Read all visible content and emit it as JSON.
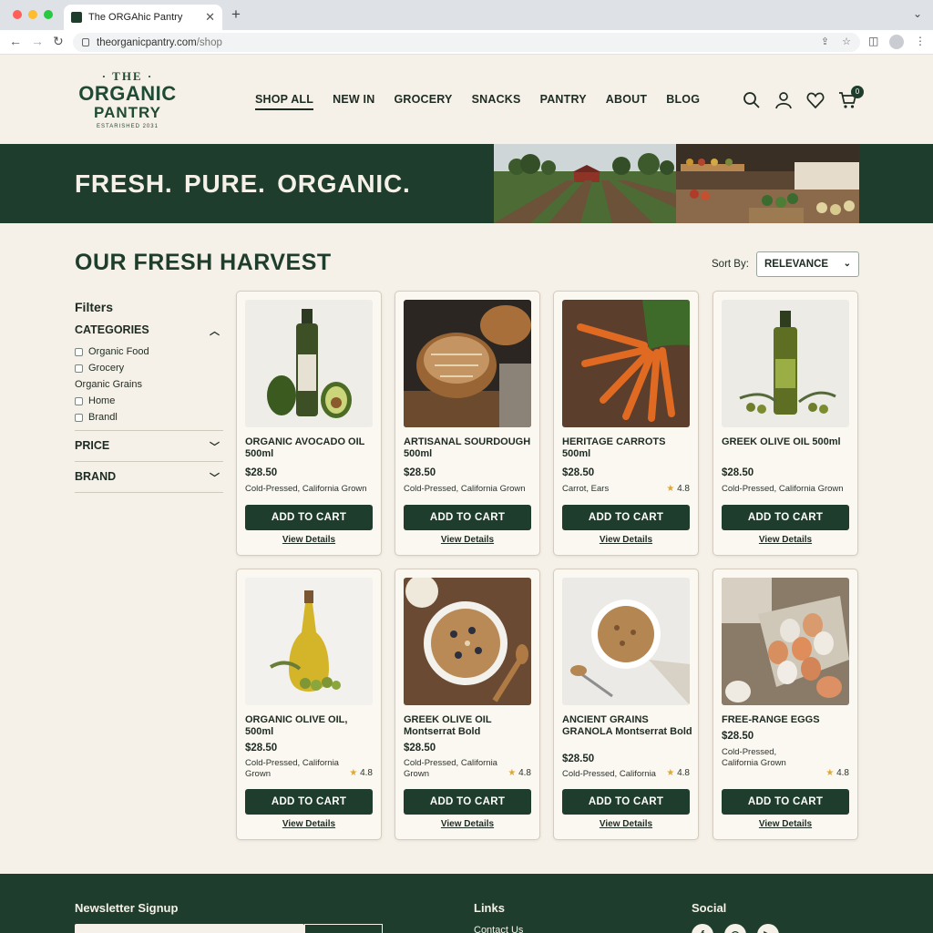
{
  "browser": {
    "tab_title": "The ORGAhic Pantry",
    "url_host": "theorganicpantry.com",
    "url_path": "/shop"
  },
  "logo": {
    "line1": "· THE ·",
    "line2": "ORGANIC",
    "line3": "PANTRY",
    "tagline": "ESTARISHED 2031"
  },
  "nav": {
    "items": [
      "SHOP ALL",
      "NEW IN",
      "GROCERY",
      "SNACKS",
      "PANTRY",
      "ABOUT",
      "BLOG"
    ]
  },
  "header_icons": {
    "search": "search-icon",
    "account": "user-icon",
    "wishlist": "heart-icon",
    "cart": "cart-icon",
    "cart_count": "0"
  },
  "hero": {
    "headline": "FRESH.  PURE. ORGANIC."
  },
  "page": {
    "title": "OUR FRESH HARVEST",
    "sort_label": "Sort By:",
    "sort_value": "RELEVANCE"
  },
  "filters": {
    "title": "Filters",
    "categories_label": "CATEGORIES",
    "categories": [
      {
        "label": "Organic Food",
        "checkbox": true
      },
      {
        "label": "Grocery",
        "checkbox": true
      },
      {
        "label": "Organic Grains",
        "checkbox": false
      },
      {
        "label": "Home",
        "checkbox": true
      },
      {
        "label": "Brandl",
        "checkbox": true
      }
    ],
    "price_label": "PRICE",
    "brand_label": "BRAND"
  },
  "products": [
    {
      "name": "ORGANIC AVOCADO OIL 500ml",
      "price": "$28.50",
      "desc": "Cold-Pressed, California Grown",
      "rating": "",
      "add": "ADD TO CART",
      "view": "View Details"
    },
    {
      "name": "ARTISANAL SOURDOUGH 500ml",
      "price": "$28.50",
      "desc": "Cold-Pressed, California Grown",
      "rating": "",
      "add": "ADD TO CART",
      "view": "View Details"
    },
    {
      "name": "HERITAGE CARROTS 500ml",
      "price": "$28.50",
      "desc": "Carrot, Ears",
      "rating": "4.8",
      "add": "ADD TO CART",
      "view": "View Details"
    },
    {
      "name": "GREEK OLIVE OIL 500ml",
      "price": "$28.50",
      "desc": "Cold-Pressed, California Grown",
      "rating": "",
      "add": "ADD TO CART",
      "view": "View Details"
    },
    {
      "name": "ORGANIC OLIVE OIL, 500ml",
      "price": "$28.50",
      "desc": "Cold-Pressed, California Grown",
      "rating": "4.8",
      "add": "ADD TO CART",
      "view": "View Details"
    },
    {
      "name": "GREEK OLIVE OIL Montserrat Bold",
      "price": "$28.50",
      "desc": "Cold-Pressed, California Grown",
      "rating": "4.8",
      "add": "ADD TO CART",
      "view": "View Details"
    },
    {
      "name": "ANCIENT GRAINS GRANOLA Montserrat Bold",
      "price": "$28.50",
      "desc": "Cold-Pressed, California",
      "rating": "4.8",
      "add": "ADD TO CART",
      "view": "View Details"
    },
    {
      "name": "FREE-RANGE EGGS",
      "price": "$28.50",
      "desc": "Cold-Pressed, California Grown",
      "rating": "4.8",
      "add": "ADD TO CART",
      "view": "View Details"
    }
  ],
  "footer": {
    "newsletter": "Newsletter Signup",
    "links": "Links",
    "contact": "Contact Us",
    "social": "Social",
    "social_icons": [
      "facebook-icon",
      "instagram-icon",
      "youtube-icon"
    ]
  },
  "colors": {
    "brand_green": "#1f3d2c",
    "cream": "#f5f1e8",
    "star": "#e0a82e"
  }
}
